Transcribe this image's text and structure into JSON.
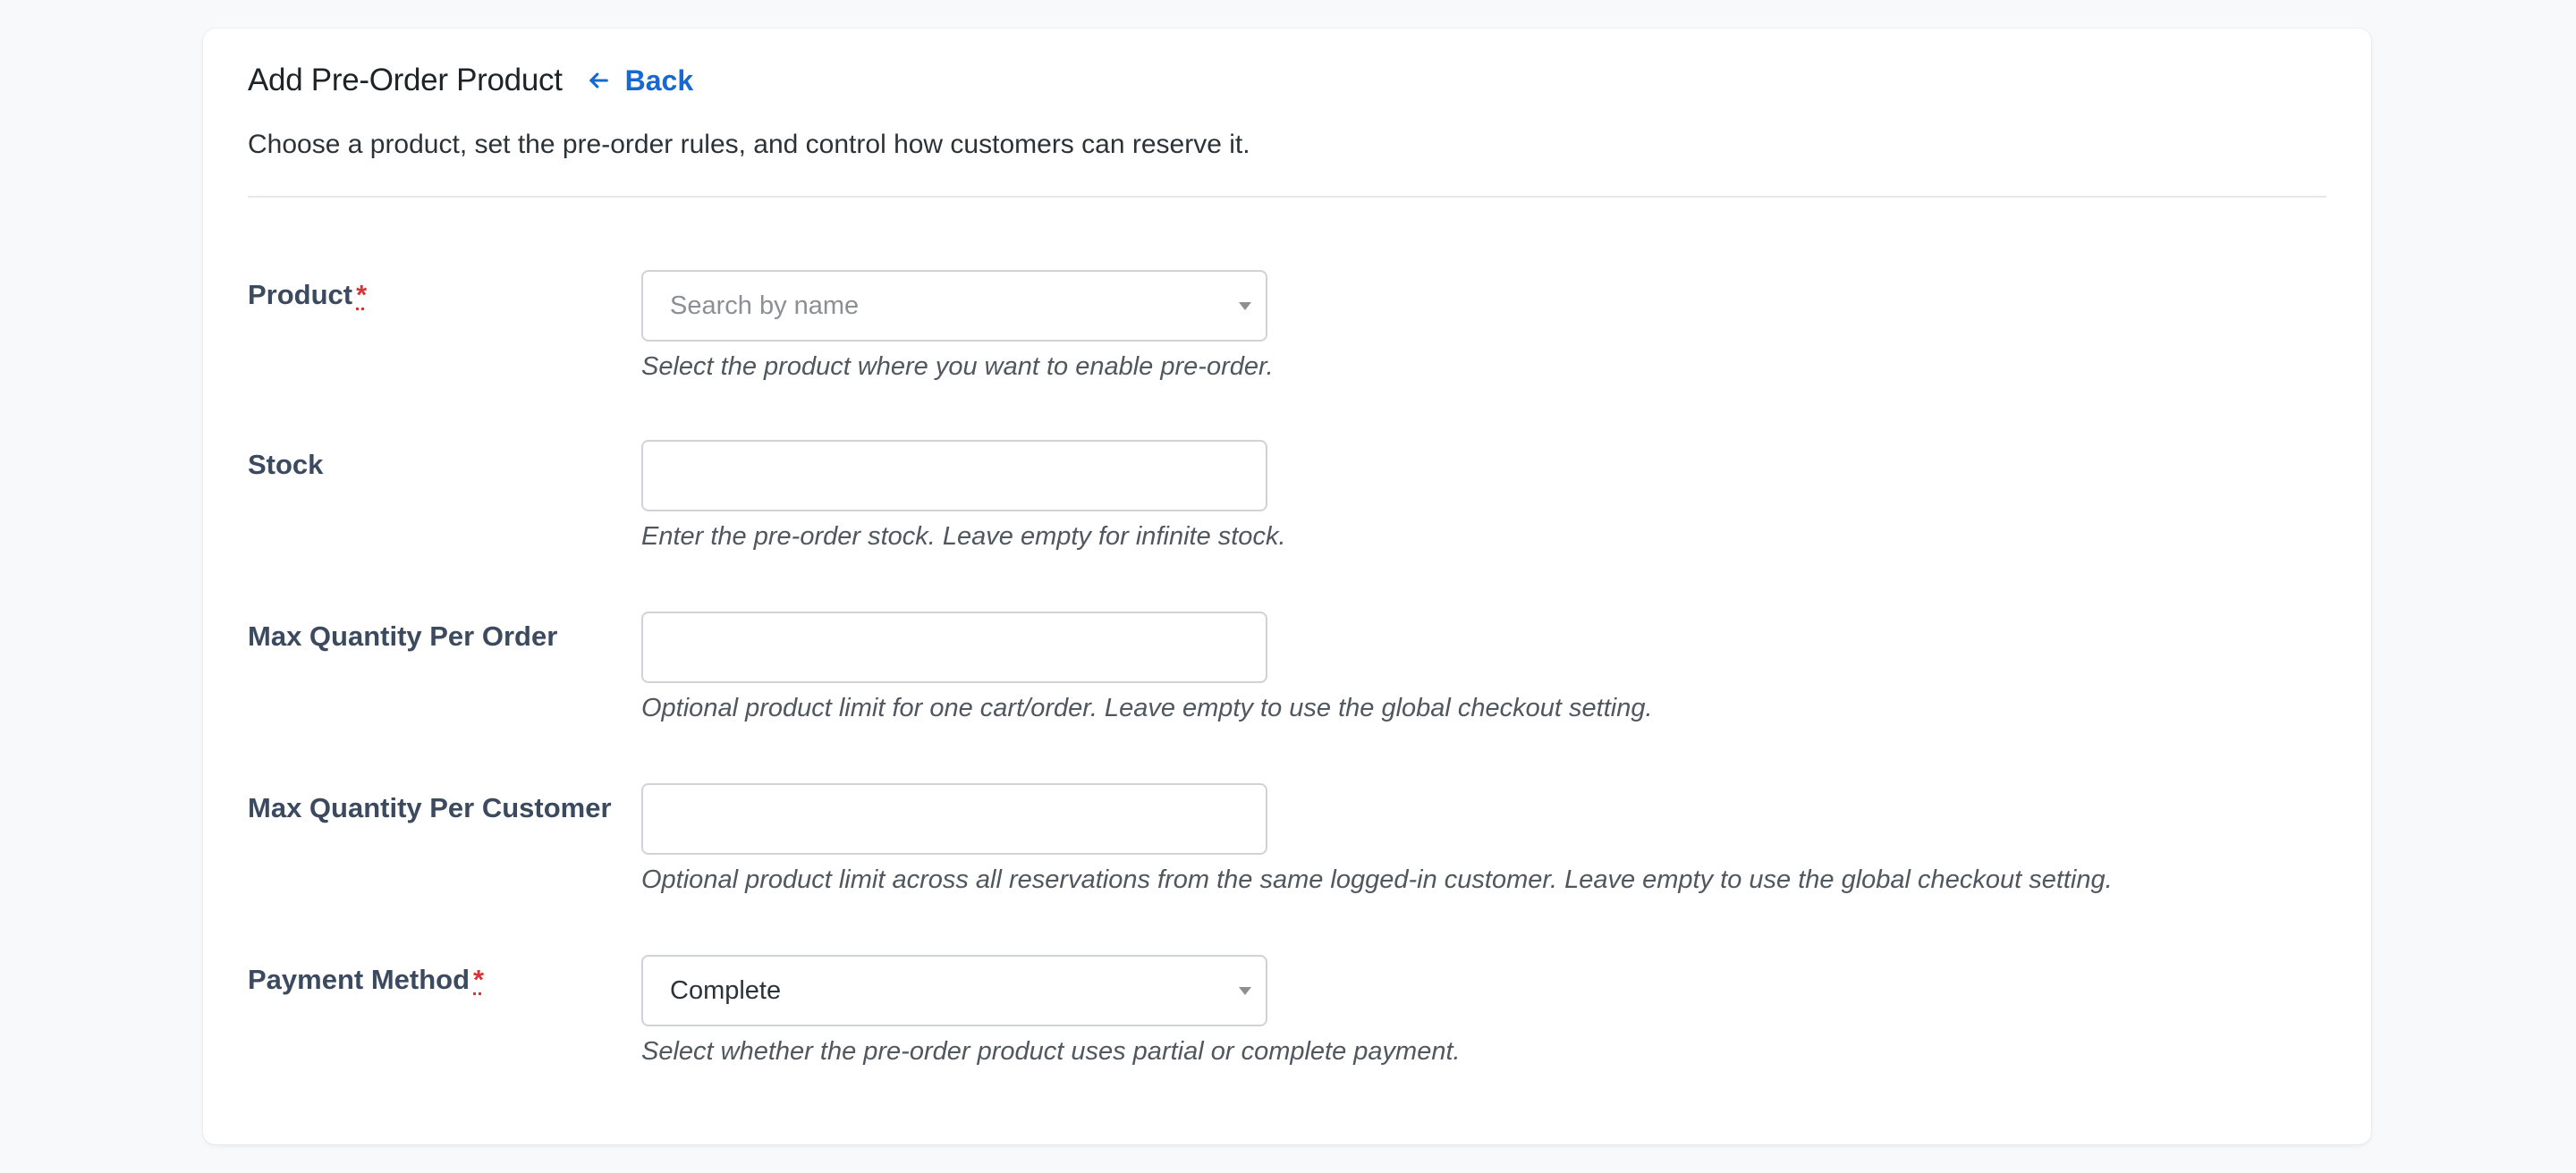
{
  "header": {
    "title": "Add Pre-Order Product",
    "back_label": "Back"
  },
  "subtitle": "Choose a product, set the pre-order rules, and control how customers can reserve it.",
  "fields": {
    "product": {
      "label": "Product",
      "required_mark": "*",
      "placeholder": "Search by name",
      "help": "Select the product where you want to enable pre-order."
    },
    "stock": {
      "label": "Stock",
      "value": "",
      "help": "Enter the pre-order stock. Leave empty for infinite stock."
    },
    "max_per_order": {
      "label": "Max Quantity Per Order",
      "value": "",
      "help": "Optional product limit for one cart/order. Leave empty to use the global checkout setting."
    },
    "max_per_customer": {
      "label": "Max Quantity Per Customer",
      "value": "",
      "help": "Optional product limit across all reservations from the same logged-in customer. Leave empty to use the global checkout setting."
    },
    "payment_method": {
      "label": "Payment Method",
      "required_mark": "*",
      "value": "Complete",
      "help": "Select whether the pre-order product uses partial or complete payment."
    }
  },
  "icons": {
    "back": "arrow-left-icon",
    "dropdown": "caret-down-icon"
  },
  "colors": {
    "link": "#1769d1",
    "required": "#d63638",
    "label": "#3b4a5f",
    "background": "#f8f9fb"
  }
}
